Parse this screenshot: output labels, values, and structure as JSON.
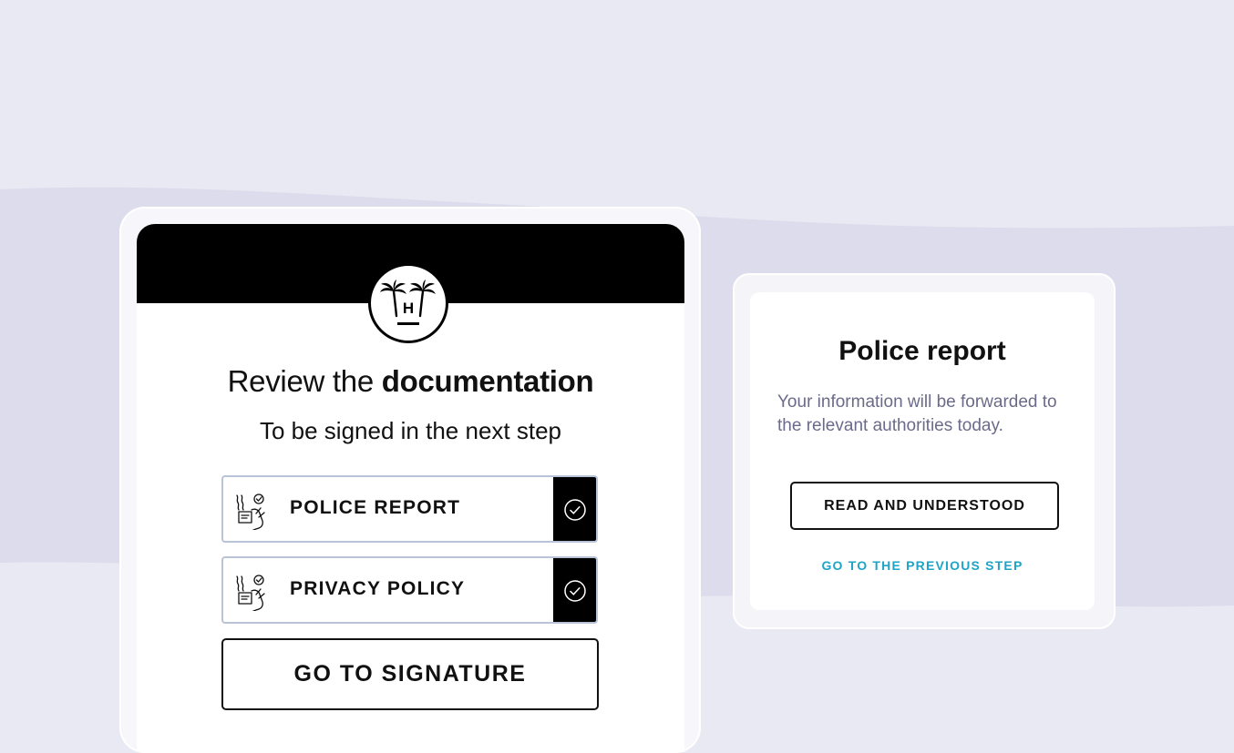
{
  "review": {
    "title_prefix": "Review the ",
    "title_bold": "documentation",
    "subtitle": "To be signed in the next step"
  },
  "documents": [
    {
      "label": "POLICE REPORT",
      "checked": true
    },
    {
      "label": "PRIVACY POLICY",
      "checked": true
    }
  ],
  "signature_button": "GO TO SIGNATURE",
  "dialog": {
    "title": "Police report",
    "text": "Your information will be forwarded to the relevant authorities today.",
    "confirm_button": "READ AND UNDERSTOOD",
    "back_link": "GO TO THE PREVIOUS STEP"
  },
  "colors": {
    "background": "#e9e9f3",
    "wave": "#dcdcec",
    "header": "#000000",
    "link": "#1ea4c6",
    "muted_text": "#6b6a8a",
    "item_border": "#b9c3d8"
  },
  "icons": {
    "logo": "palm-trees-h-logo",
    "document": "hand-signing-document-icon",
    "check": "check-circle-icon"
  }
}
